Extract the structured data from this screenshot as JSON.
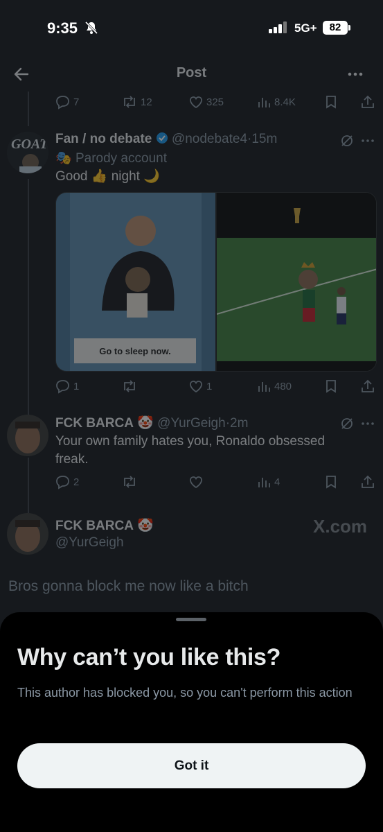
{
  "status_bar": {
    "time": "9:35",
    "network": "5G+",
    "battery": "82"
  },
  "header": {
    "title": "Post"
  },
  "top_actions": {
    "replies": "7",
    "reposts": "12",
    "likes": "325",
    "views": "8.4K"
  },
  "tweet1": {
    "name": "Fan / no debate",
    "handle": "@nodebate4",
    "time": "15m",
    "badge": "Parody account",
    "text_good": "Good",
    "text_night": "night",
    "avatar_text": "GOAT",
    "image_caption": "Go to sleep now.",
    "actions": {
      "replies": "1",
      "likes": "1",
      "views": "480"
    }
  },
  "tweet2": {
    "name": "FCK BARCA",
    "handle": "@YurGeigh",
    "time": "2m",
    "text": "Your own family hates you, Ronaldo obsessed freak.",
    "actions": {
      "replies": "2",
      "views": "4"
    }
  },
  "tweet3": {
    "name": "FCK BARCA",
    "handle": "@YurGeigh",
    "watermark": "X.com"
  },
  "reply_text": "Bros gonna block me now like a bitch",
  "sheet": {
    "title": "Why can’t you like this?",
    "subtitle": "This author has blocked you, so you can't perform this action",
    "button": "Got it"
  },
  "colors": {
    "sheet_bg": "#000000",
    "button_bg": "#eff3f4",
    "verified": "#1d9bf0"
  }
}
